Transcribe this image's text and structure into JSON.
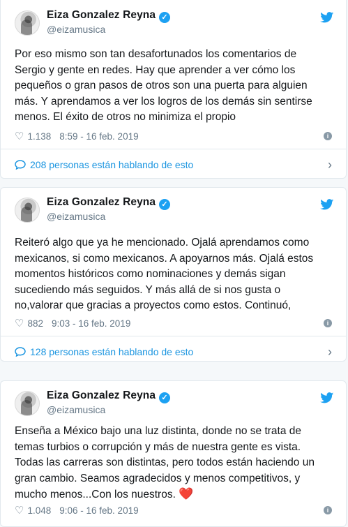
{
  "tweets": [
    {
      "author": "Eiza Gonzalez Reyna",
      "handle": "@eizamusica",
      "text": "Por eso mismo son tan desafortunados los comentarios de\nSergio y gente en redes. Hay que aprender a ver cómo los\npequeños o gran pasos de otros son una puerta para alguien\nmás. Y aprendamos a ver los logros de los demás sin sentirse\nmenos. El éxito de otros no minimiza el propio",
      "likes": "1.138",
      "timestamp": "8:59 - 16 feb. 2019",
      "conversation": "208 personas están hablando de esto"
    },
    {
      "author": "Eiza Gonzalez Reyna",
      "handle": "@eizamusica",
      "text": "Reiteró algo que ya he mencionado. Ojalá aprendamos como\nmexicanos, si como mexicanos. A apoyarnos más. Ojalá estos\nmomentos históricos como nominaciones y demás sigan\nsucediendo más seguidos. Y más allá de si nos gusta o\nno,valorar que gracias a proyectos como estos. Continuó,",
      "likes": "882",
      "timestamp": "9:03 - 16 feb. 2019",
      "conversation": "128 personas están hablando de esto"
    },
    {
      "author": "Eiza Gonzalez Reyna",
      "handle": "@eizamusica",
      "text": "Enseña a México bajo una luz distinta, donde no se trata de\ntemas turbios o corrupción y más de nuestra gente es vista.\nTodas las carreras son distintas, pero todos están haciendo un\ngran cambio. Seamos agradecidos y menos competitivos, y\nmucho menos...Con los nuestros.",
      "emoji": "❤️",
      "likes": "1.048",
      "timestamp": "9:06 - 16 feb. 2019"
    }
  ],
  "icons": {
    "verified": "verified-badge-icon",
    "bird": "twitter-bird-icon",
    "heart": "heart-icon",
    "info": "info-icon",
    "bubble": "comment-bubble-icon",
    "chevron": "chevron-right-icon"
  },
  "colors": {
    "accent": "#1da1f2",
    "link": "#1b95e0",
    "muted": "#657786",
    "heart": "#e0245e"
  }
}
